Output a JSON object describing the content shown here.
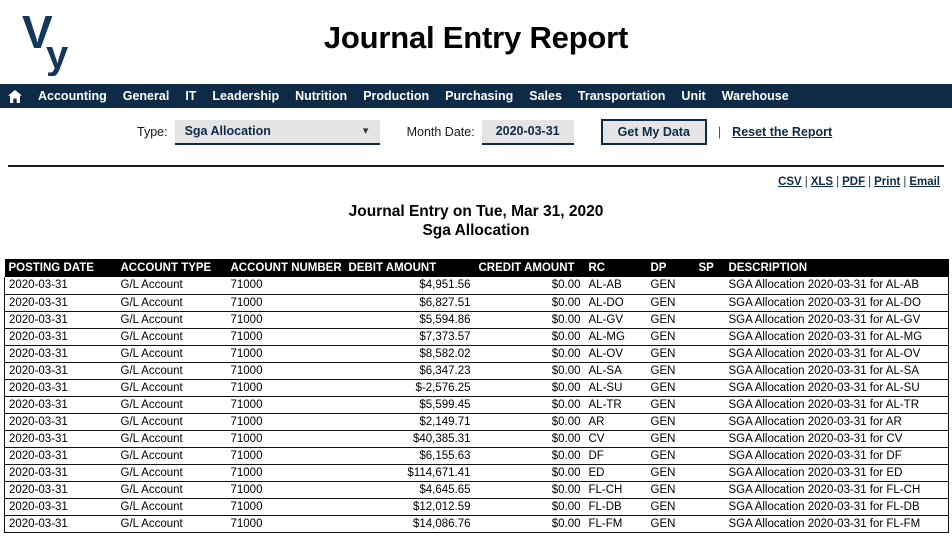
{
  "header": {
    "logo_text_primary": "V",
    "logo_text_secondary": "y",
    "logo_name": "vy-logo",
    "title": "Journal Entry Report"
  },
  "nav": {
    "home_icon": "home-icon",
    "items": [
      {
        "label": "Accounting"
      },
      {
        "label": "General"
      },
      {
        "label": "IT"
      },
      {
        "label": "Leadership"
      },
      {
        "label": "Nutrition"
      },
      {
        "label": "Production"
      },
      {
        "label": "Purchasing"
      },
      {
        "label": "Sales"
      },
      {
        "label": "Transportation"
      },
      {
        "label": "Unit"
      },
      {
        "label": "Warehouse"
      }
    ]
  },
  "filters": {
    "type_label": "Type:",
    "type_value": "Sga Allocation",
    "type_chevron_icon": "chevron-down-icon",
    "month_label": "Month Date:",
    "month_value": "2020-03-31",
    "month_placeholder": "YYYY-MM-DD",
    "get_data_label": "Get My Data",
    "divider": "|",
    "reset_label": "Reset the Report"
  },
  "exports": {
    "csv": "CSV",
    "xls": "XLS",
    "pdf": "PDF",
    "print": "Print",
    "email": "Email",
    "sep": "|"
  },
  "report": {
    "heading_line1": "Journal Entry on Tue, Mar 31, 2020",
    "heading_line2": "Sga Allocation"
  },
  "table": {
    "columns": [
      "POSTING DATE",
      "ACCOUNT TYPE",
      "ACCOUNT NUMBER",
      "DEBIT AMOUNT",
      "CREDIT AMOUNT",
      "RC",
      "DP",
      "SP",
      "DESCRIPTION"
    ],
    "rows": [
      [
        "2020-03-31",
        "G/L Account",
        "71000",
        "$4,951.56",
        "$0.00",
        "AL-AB",
        "GEN",
        "",
        "SGA Allocation 2020-03-31 for AL-AB"
      ],
      [
        "2020-03-31",
        "G/L Account",
        "71000",
        "$6,827.51",
        "$0.00",
        "AL-DO",
        "GEN",
        "",
        "SGA Allocation 2020-03-31 for AL-DO"
      ],
      [
        "2020-03-31",
        "G/L Account",
        "71000",
        "$5,594.86",
        "$0.00",
        "AL-GV",
        "GEN",
        "",
        "SGA Allocation 2020-03-31 for AL-GV"
      ],
      [
        "2020-03-31",
        "G/L Account",
        "71000",
        "$7,373.57",
        "$0.00",
        "AL-MG",
        "GEN",
        "",
        "SGA Allocation 2020-03-31 for AL-MG"
      ],
      [
        "2020-03-31",
        "G/L Account",
        "71000",
        "$8,582.02",
        "$0.00",
        "AL-OV",
        "GEN",
        "",
        "SGA Allocation 2020-03-31 for AL-OV"
      ],
      [
        "2020-03-31",
        "G/L Account",
        "71000",
        "$6,347.23",
        "$0.00",
        "AL-SA",
        "GEN",
        "",
        "SGA Allocation 2020-03-31 for AL-SA"
      ],
      [
        "2020-03-31",
        "G/L Account",
        "71000",
        "$-2,576.25",
        "$0.00",
        "AL-SU",
        "GEN",
        "",
        "SGA Allocation 2020-03-31 for AL-SU"
      ],
      [
        "2020-03-31",
        "G/L Account",
        "71000",
        "$5,599.45",
        "$0.00",
        "AL-TR",
        "GEN",
        "",
        "SGA Allocation 2020-03-31 for AL-TR"
      ],
      [
        "2020-03-31",
        "G/L Account",
        "71000",
        "$2,149.71",
        "$0.00",
        "AR",
        "GEN",
        "",
        "SGA Allocation 2020-03-31 for AR"
      ],
      [
        "2020-03-31",
        "G/L Account",
        "71000",
        "$40,385.31",
        "$0.00",
        "CV",
        "GEN",
        "",
        "SGA Allocation 2020-03-31 for CV"
      ],
      [
        "2020-03-31",
        "G/L Account",
        "71000",
        "$6,155.63",
        "$0.00",
        "DF",
        "GEN",
        "",
        "SGA Allocation 2020-03-31 for DF"
      ],
      [
        "2020-03-31",
        "G/L Account",
        "71000",
        "$114,671.41",
        "$0.00",
        "ED",
        "GEN",
        "",
        "SGA Allocation 2020-03-31 for ED"
      ],
      [
        "2020-03-31",
        "G/L Account",
        "71000",
        "$4,645.65",
        "$0.00",
        "FL-CH",
        "GEN",
        "",
        "SGA Allocation 2020-03-31 for FL-CH"
      ],
      [
        "2020-03-31",
        "G/L Account",
        "71000",
        "$12,012.59",
        "$0.00",
        "FL-DB",
        "GEN",
        "",
        "SGA Allocation 2020-03-31 for FL-DB"
      ],
      [
        "2020-03-31",
        "G/L Account",
        "71000",
        "$14,086.76",
        "$0.00",
        "FL-FM",
        "GEN",
        "",
        "SGA Allocation 2020-03-31 for FL-FM"
      ]
    ]
  },
  "colors": {
    "brand_navy": "#0d2b47",
    "header_black": "#000000",
    "field_gray": "#e4e4e4"
  }
}
